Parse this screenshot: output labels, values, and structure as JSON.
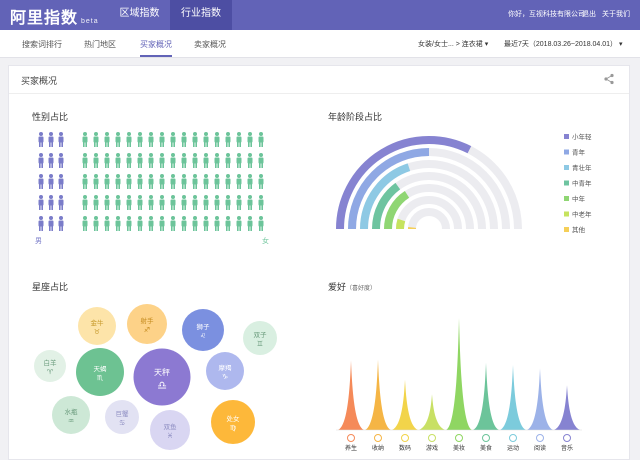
{
  "app": {
    "logo": "阿里指数",
    "beta": "beta",
    "nav": [
      "区域指数",
      "行业指数"
    ],
    "greeting": "你好，互视科技有限公司",
    "logout": "退出",
    "about": "关于我们"
  },
  "tabs": [
    "搜索词排行",
    "热门地区",
    "买家概况",
    "卖家概况"
  ],
  "filters": {
    "category": "女装/女士... > 连衣裙",
    "date": "最近7天（2018.03.26~2018.04.01）"
  },
  "card": {
    "title": "买家概况"
  },
  "gender": {
    "title": "性别占比",
    "male_label": "男",
    "female_label": "女",
    "male_count": 15,
    "female_count": 85,
    "male_color": "#7a7cc9",
    "female_color": "#6cc49a"
  },
  "age": {
    "title": "年龄阶段占比",
    "legend": [
      {
        "name": "小年轻",
        "color": "#8683d1",
        "value": 0.65
      },
      {
        "name": "青年",
        "color": "#8fa8e4",
        "value": 0.5
      },
      {
        "name": "青壮年",
        "color": "#8ec9e4",
        "value": 0.4
      },
      {
        "name": "中青年",
        "color": "#6ec4a0",
        "value": 0.3
      },
      {
        "name": "中年",
        "color": "#8fd673",
        "value": 0.32
      },
      {
        "name": "中老年",
        "color": "#c6e35e",
        "value": 0.1
      },
      {
        "name": "其他",
        "color": "#f5cf58",
        "value": 0.03
      }
    ]
  },
  "constellation": {
    "title": "星座占比",
    "items": [
      {
        "name": "金牛",
        "symbol": "♉",
        "color": "#fde4a9",
        "text": "#c79a2c",
        "value": 38
      },
      {
        "name": "射手",
        "symbol": "♐",
        "color": "#fdd288",
        "text": "#c48a1c",
        "value": 40
      },
      {
        "name": "狮子",
        "symbol": "♌",
        "color": "#7b90e0",
        "text": "#ffffff",
        "value": 42
      },
      {
        "name": "双子",
        "symbol": "♊",
        "color": "#d9efe1",
        "text": "#6a9b7c",
        "value": 34
      },
      {
        "name": "白羊",
        "symbol": "♈",
        "color": "#e2f1e6",
        "text": "#6a9b7c",
        "value": 32
      },
      {
        "name": "天蝎",
        "symbol": "♏",
        "color": "#6dc292",
        "text": "#ffffff",
        "value": 48
      },
      {
        "name": "天秤",
        "symbol": "♎",
        "color": "#8c79d2",
        "text": "#ffffff",
        "value": 57
      },
      {
        "name": "摩羯",
        "symbol": "♑",
        "color": "#aeb8ee",
        "text": "#ffffff",
        "value": 38
      },
      {
        "name": "水瓶",
        "symbol": "♒",
        "color": "#cde8d6",
        "text": "#6a9b7c",
        "value": 38
      },
      {
        "name": "巨蟹",
        "symbol": "♋",
        "color": "#e2e2f3",
        "text": "#8e8ec2",
        "value": 34
      },
      {
        "name": "双鱼",
        "symbol": "♓",
        "color": "#d9d6f2",
        "text": "#8e8ec2",
        "value": 40
      },
      {
        "name": "处女",
        "symbol": "♍",
        "color": "#fdb83a",
        "text": "#ffffff",
        "value": 44
      }
    ]
  },
  "hobby": {
    "title": "爱好",
    "subtitle": "（喜好度）",
    "items": [
      {
        "name": "养生",
        "color": "#f58a59",
        "value": 0.62
      },
      {
        "name": "收纳",
        "color": "#f5b545",
        "value": 0.63
      },
      {
        "name": "数码",
        "color": "#f2d44a",
        "value": 0.45
      },
      {
        "name": "游戏",
        "color": "#c8e064",
        "value": 0.32
      },
      {
        "name": "美妆",
        "color": "#8fd662",
        "value": 1.0
      },
      {
        "name": "美食",
        "color": "#6cc49a",
        "value": 0.6
      },
      {
        "name": "运动",
        "color": "#7ccbdc",
        "value": 0.58
      },
      {
        "name": "阅读",
        "color": "#9cb2e8",
        "value": 0.55
      },
      {
        "name": "音乐",
        "color": "#8683d1",
        "value": 0.4
      }
    ]
  }
}
